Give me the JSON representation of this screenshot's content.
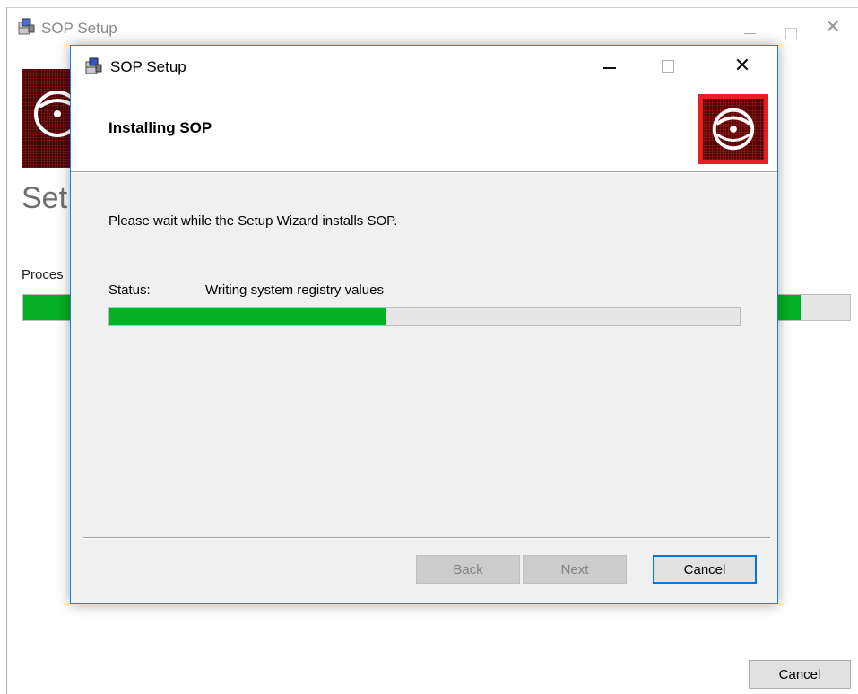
{
  "background_window": {
    "title": "SOP Setup",
    "heading": "Set",
    "progress_label": "Proces",
    "progress_fraction": 0.94,
    "cancel_label": "Cancel"
  },
  "dialog": {
    "title": "SOP Setup",
    "banner_title": "Installing SOP",
    "message": "Please wait while the Setup Wizard installs SOP.",
    "status_label": "Status:",
    "status_value": "Writing system registry values",
    "progress_fraction": 0.44,
    "buttons": {
      "back": "Back",
      "next": "Next",
      "cancel": "Cancel"
    },
    "controls": {
      "close_glyph": "✕"
    }
  },
  "icons": {
    "app": "installer-icon",
    "banner": "disc-icon"
  },
  "colors": {
    "progress": "#06b025",
    "accent_border": "#1883d7",
    "logo_frame": "#e81e25"
  }
}
